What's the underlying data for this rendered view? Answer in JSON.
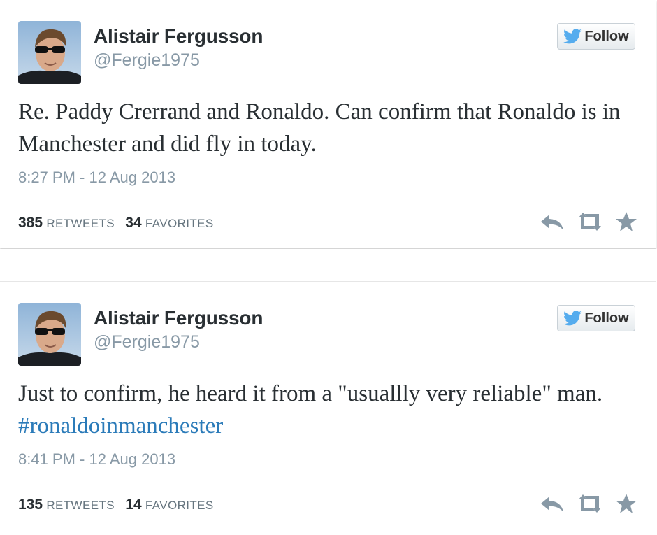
{
  "tweets": [
    {
      "name": "Alistair Fergusson",
      "handle": "@Fergie1975",
      "follow_label": "Follow",
      "text": "Re. Paddy Crerrand and Ronaldo. Can confirm that Ronaldo is in Manchester and did fly in today.",
      "hashtag": "",
      "timestamp": "8:27 PM - 12 Aug 2013",
      "retweets_count": "385",
      "retweets_label": "RETWEETS",
      "favorites_count": "34",
      "favorites_label": "FAVORITES"
    },
    {
      "name": "Alistair Fergusson",
      "handle": "@Fergie1975",
      "follow_label": "Follow",
      "text": "Just to confirm, he heard it from a \"usuallly very reliable\" man.",
      "hashtag": "#ronaldoinmanchester",
      "timestamp": "8:41 PM - 12 Aug 2013",
      "retweets_count": "135",
      "retweets_label": "RETWEETS",
      "favorites_count": "14",
      "favorites_label": "FAVORITES"
    }
  ],
  "icons": {
    "bird": "twitter-bird-icon",
    "reply": "reply-icon",
    "retweet": "retweet-icon",
    "favorite": "star-icon"
  },
  "colors": {
    "twitter_blue": "#55acee",
    "hashtag": "#2b7bb9",
    "meta_gray": "#8899a6",
    "action_gray": "#8899a6"
  }
}
